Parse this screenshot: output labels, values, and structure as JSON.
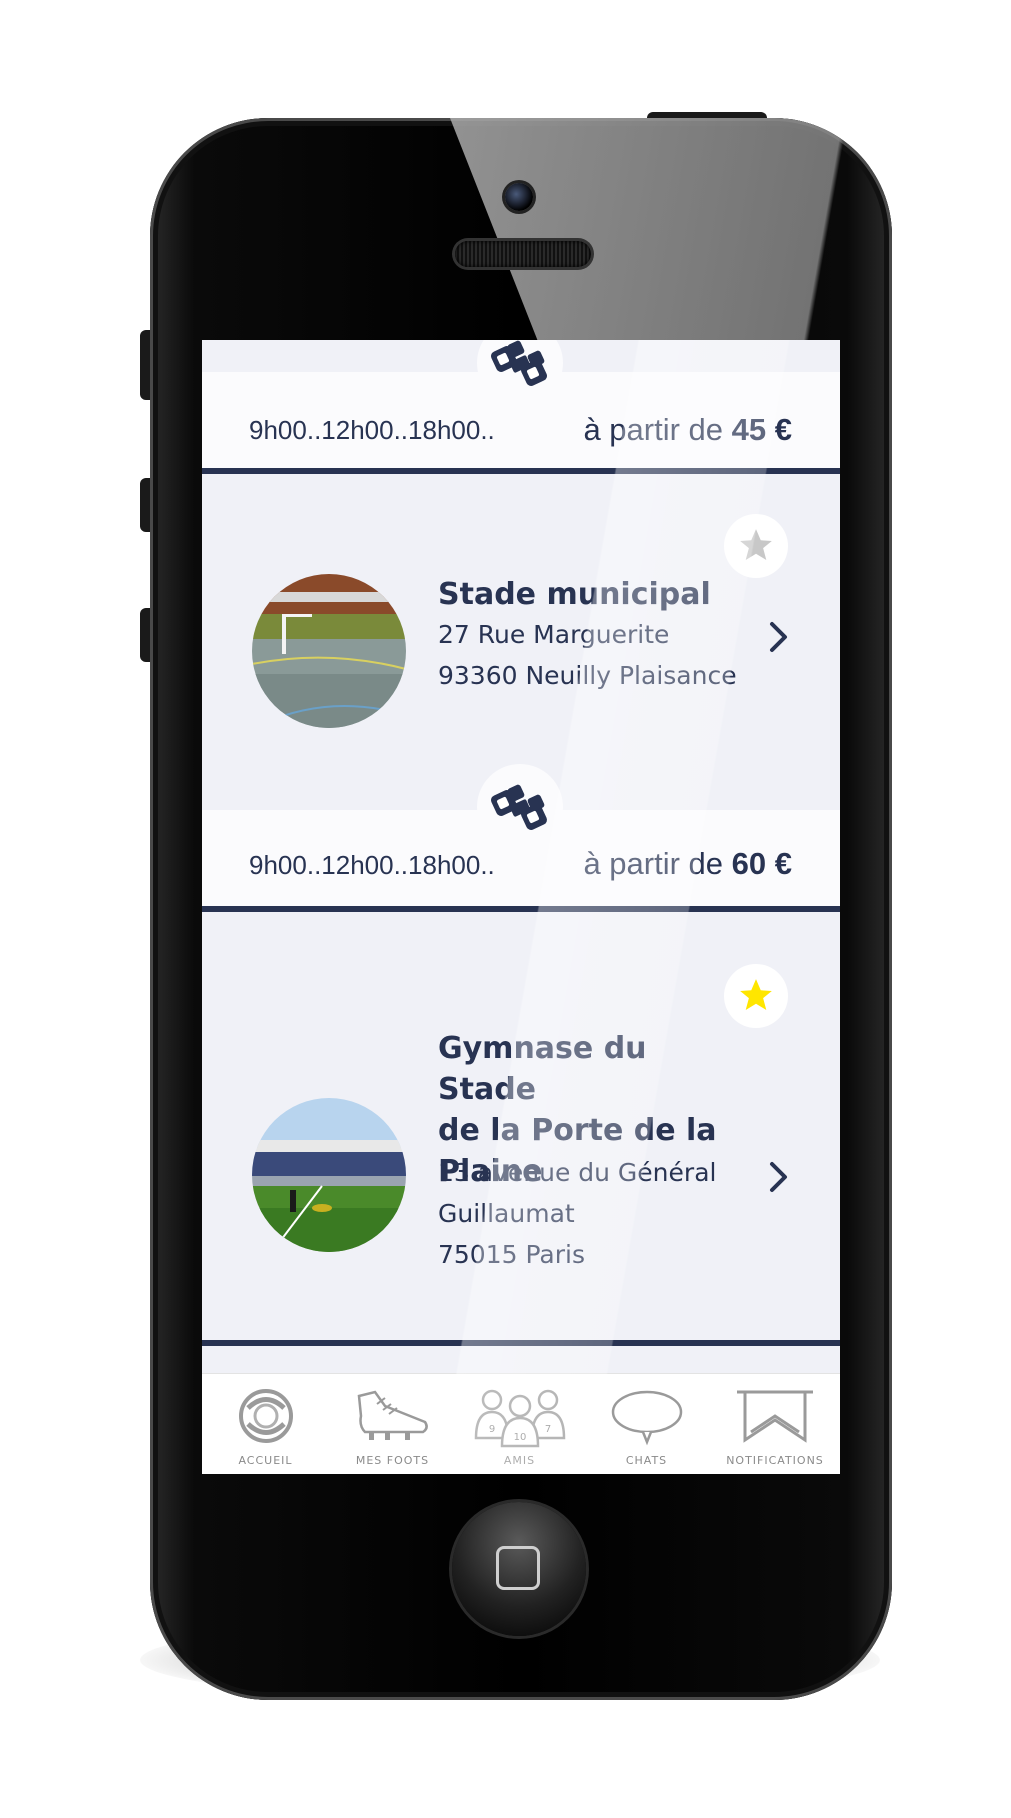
{
  "listing": [
    {
      "hours": "9h00..12h00..18h00..",
      "price_prefix": "à partir de",
      "price_value": "45 €"
    },
    {
      "name": "Stade municipal",
      "address_lines": [
        "27 Rue Marguerite",
        "93360 Neuilly Plaisance"
      ],
      "favorite": false,
      "hours": "9h00..12h00..18h00..",
      "price_prefix": "à partir de",
      "price_value": "60 €"
    },
    {
      "name_lines": [
        "Gymnase du Stade",
        "de la Porte de la",
        "Plaine"
      ],
      "address_lines": [
        "13 avenue du Général",
        "Guillaumat",
        "75015 Paris"
      ],
      "favorite": true
    }
  ],
  "tabbar": {
    "items": [
      {
        "label": "ACCUEIL",
        "icon": "aperture-icon"
      },
      {
        "label": "MES FOOTS",
        "icon": "football-boot-icon"
      },
      {
        "label": "AMIS",
        "icon": "friends-icon",
        "numbers": [
          "9",
          "10",
          "7"
        ]
      },
      {
        "label": "CHATS",
        "icon": "chat-bubble-icon"
      },
      {
        "label": "NOTIFICATIONS",
        "icon": "bookmark-icon"
      }
    ]
  },
  "colors": {
    "navy": "#283352",
    "card_bg": "#f0f1f7",
    "band_bg": "#fbfbfd",
    "star_active": "#ffe600",
    "star_inactive": "#c8c8c8",
    "tab_gray": "#8a8a8a"
  }
}
